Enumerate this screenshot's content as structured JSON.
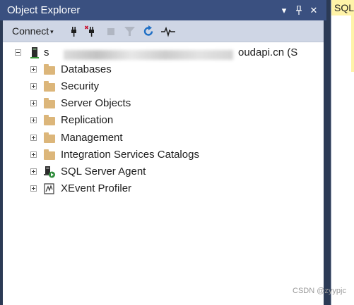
{
  "panel": {
    "title": "Object Explorer",
    "buttons": [
      {
        "name": "dropdown-icon",
        "glyph": "▾"
      },
      {
        "name": "pin-icon",
        "glyph": "ᛘ"
      },
      {
        "name": "close-icon",
        "glyph": "✕"
      }
    ]
  },
  "toolbar": {
    "connect_label": "Connect",
    "connect_caret": "▾",
    "icons": [
      "connect-plug-icon",
      "disconnect-plug-icon",
      "stop-icon",
      "filter-icon",
      "refresh-icon",
      "activity-monitor-icon"
    ]
  },
  "tree": {
    "server": {
      "prefix": "s",
      "suffix": "oudapi.cn (S",
      "expander": "minus"
    },
    "children": [
      {
        "label": "Databases",
        "icon": "folder-icon"
      },
      {
        "label": "Security",
        "icon": "folder-icon"
      },
      {
        "label": "Server Objects",
        "icon": "folder-icon"
      },
      {
        "label": "Replication",
        "icon": "folder-icon"
      },
      {
        "label": "Management",
        "icon": "folder-icon"
      },
      {
        "label": "Integration Services Catalogs",
        "icon": "folder-icon"
      },
      {
        "label": "SQL Server Agent",
        "icon": "sql-agent-icon"
      },
      {
        "label": "XEvent Profiler",
        "icon": "xevent-profiler-icon"
      }
    ]
  },
  "rightpane": {
    "tab_label": "SQL"
  },
  "watermark": "CSDN @zyypjc",
  "colors": {
    "titlebar": "#3a5080",
    "toolbar": "#cfd6e5",
    "folder": "#dcb67a",
    "tab": "#fff3a8"
  }
}
